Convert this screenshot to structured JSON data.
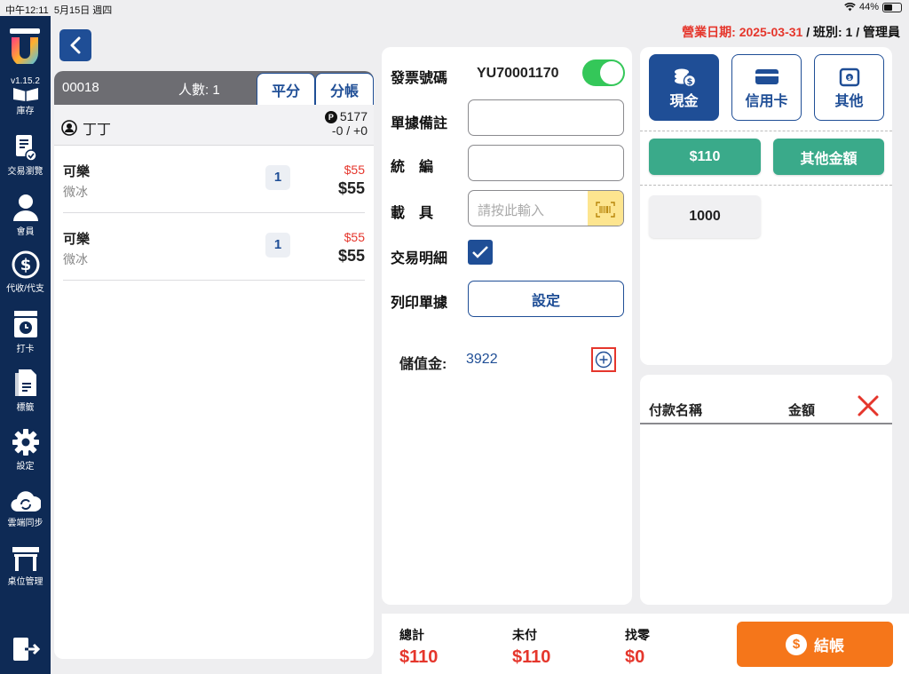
{
  "status_bar": {
    "time": "中午12:11",
    "date": "5月15日 週四",
    "battery": "44%"
  },
  "sidebar": {
    "version": "v1.15.2",
    "items": [
      {
        "label": "庫存",
        "icon": "inventory-icon"
      },
      {
        "label": "交易瀏覽",
        "icon": "transaction-icon"
      },
      {
        "label": "會員",
        "icon": "member-icon"
      },
      {
        "label": "代收/代支",
        "icon": "collect-pay-icon"
      },
      {
        "label": "打卡",
        "icon": "clock-in-icon"
      },
      {
        "label": "標籤",
        "icon": "label-icon"
      },
      {
        "label": "設定",
        "icon": "settings-gear-icon"
      },
      {
        "label": "雲端同步",
        "icon": "cloud-sync-icon"
      },
      {
        "label": "桌位管理",
        "icon": "table-icon"
      }
    ]
  },
  "header": {
    "biz_label": "營業日期:",
    "biz_date": "2025-03-31",
    "shift": "/ 班別: 1 / 管理員"
  },
  "order": {
    "number": "00018",
    "people": "人數: 1",
    "tab_split": "平分",
    "tab_separate": "分帳",
    "member_name": "丁丁",
    "points": "5177",
    "points_delta": "-0 / +0",
    "items": [
      {
        "name": "可樂",
        "note": "微冰",
        "qty": "1",
        "orig_price": "$55",
        "price": "$55"
      },
      {
        "name": "可樂",
        "note": "微冰",
        "qty": "1",
        "orig_price": "$55",
        "price": "$55"
      }
    ]
  },
  "invoice": {
    "number_label": "發票號碼",
    "number": "YU70001170",
    "remark_label": "單據備註",
    "tax_id_label": "統　編",
    "carrier_label": "載　具",
    "carrier_placeholder": "請按此輸入",
    "detail_label": "交易明細",
    "print_label": "列印單據",
    "print_button": "設定",
    "stored_value_label": "儲值金:",
    "stored_value": "3922"
  },
  "payment": {
    "methods": [
      {
        "label": "現金",
        "active": true
      },
      {
        "label": "信用卡",
        "active": false
      },
      {
        "label": "其他",
        "active": false
      }
    ],
    "exact_amount": "$110",
    "other_amount": "其他金額",
    "quick_amount": "1000"
  },
  "records": {
    "col_name": "付款名稱",
    "col_amount": "金額"
  },
  "totals": {
    "total_label": "總計",
    "total": "$110",
    "unpaid_label": "未付",
    "unpaid": "$110",
    "change_label": "找零",
    "change": "$0"
  },
  "checkout_label": "結帳",
  "colors": {
    "primary": "#1f4e96",
    "sidebar": "#0e2a55",
    "accent_red": "#e5362c",
    "green": "#3aaa8a",
    "orange": "#f5761a"
  }
}
